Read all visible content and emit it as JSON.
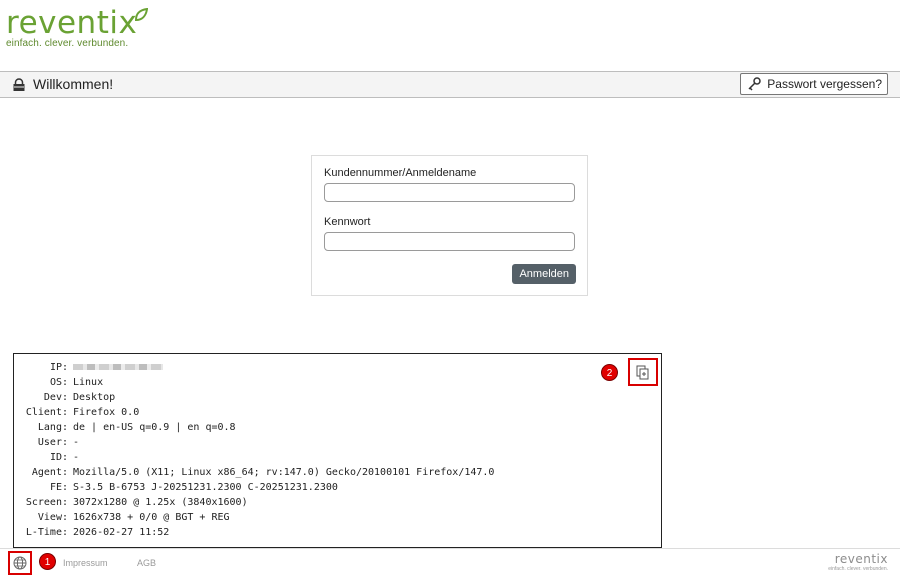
{
  "brand": {
    "name": "reventix",
    "tagline": "einfach. clever. verbunden.",
    "color": "#6aa234"
  },
  "header": {
    "title": "Willkommen!",
    "lock_icon": "lock-icon",
    "forgot_password": "Passwort vergessen?",
    "forgot_icon": "key-icon"
  },
  "login": {
    "username_label": "Kundennummer/Anmeldename",
    "username_value": "",
    "password_label": "Kennwort",
    "password_value": "",
    "submit": "Anmelden"
  },
  "info": {
    "rows": [
      {
        "key": "IP:",
        "value": ""
      },
      {
        "key": "OS:",
        "value": "Linux"
      },
      {
        "key": "Dev:",
        "value": "Desktop"
      },
      {
        "key": "Client:",
        "value": "Firefox 0.0"
      },
      {
        "key": "Lang:",
        "value": "de | en-US q=0.9 | en q=0.8"
      },
      {
        "key": "User:",
        "value": "-"
      },
      {
        "key": "ID:",
        "value": "-"
      },
      {
        "key": "Agent:",
        "value": "Mozilla/5.0 (X11; Linux x86_64; rv:147.0) Gecko/20100101 Firefox/147.0"
      },
      {
        "key": "FE:",
        "value": "S-3.5 B-6753 J-20251231.2300 C-20251231.2300"
      },
      {
        "key": "Screen:",
        "value": "3072x1280 @ 1.25x (3840x1600)"
      },
      {
        "key": "View:",
        "value": "1626x738 + 0/0 @ BGT + REG"
      },
      {
        "key": "L-Time:",
        "value": "2026-02-27 11:52"
      }
    ],
    "copy_icon": "copy-icon"
  },
  "badges": {
    "one": "1",
    "two": "2"
  },
  "footer": {
    "globe_icon": "globe-icon",
    "impressum": "Impressum",
    "agb": "AGB",
    "logo_name": "reventix",
    "logo_tagline": "einfach. clever. verbunden."
  }
}
